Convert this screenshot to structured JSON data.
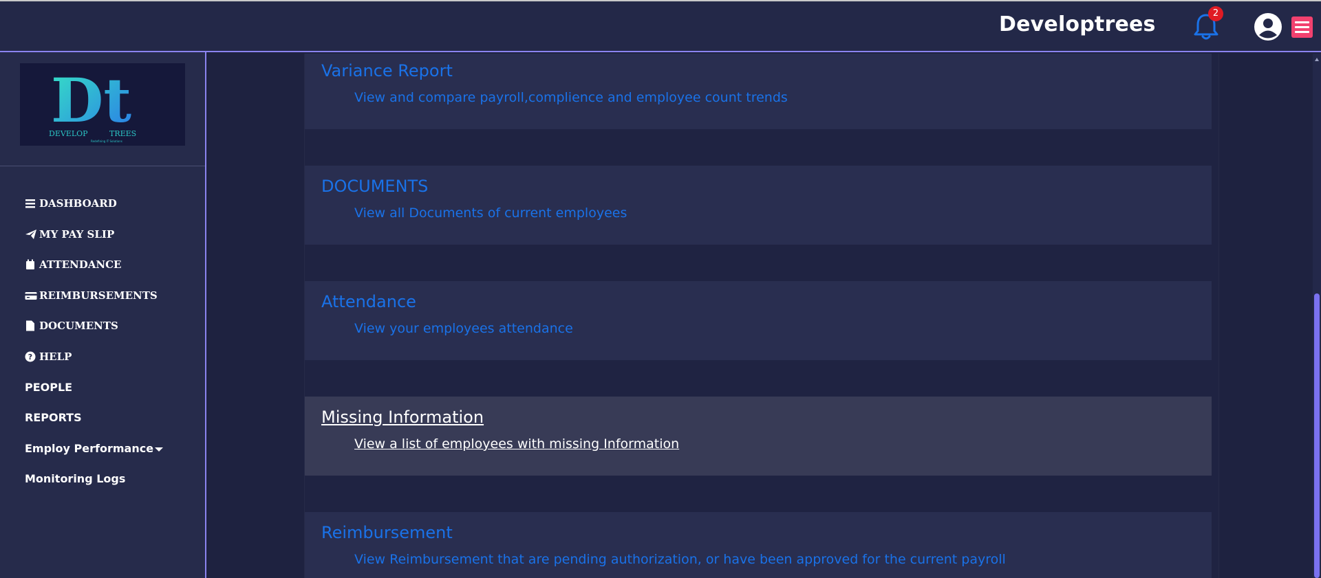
{
  "header": {
    "brand": "Developtrees",
    "notification_count": "2"
  },
  "logo": {
    "monogram": "Dt",
    "wordmark_left": "DEVELOP",
    "wordmark_right": "TREES",
    "tagline": "Redefining IT Solutions"
  },
  "sidebar": {
    "items": [
      {
        "label": "DASHBOARD",
        "icon": "bars-icon"
      },
      {
        "label": "MY PAY SLIP",
        "icon": "paper-plane-icon"
      },
      {
        "label": "ATTENDANCE",
        "icon": "calendar-icon"
      },
      {
        "label": "REIMBURSEMENTS",
        "icon": "credit-card-icon"
      },
      {
        "label": "DOCUMENTS",
        "icon": "file-icon"
      },
      {
        "label": "HELP",
        "icon": "question-circle-icon"
      },
      {
        "label": "PEOPLE",
        "icon": ""
      },
      {
        "label": "REPORTS",
        "icon": ""
      },
      {
        "label": "Employ Performance",
        "icon": "caret-down-icon"
      },
      {
        "label": "Monitoring Logs",
        "icon": ""
      }
    ]
  },
  "reports": [
    {
      "title": "Variance Report",
      "description": "View and compare payroll,complience and employee count trends"
    },
    {
      "title": "DOCUMENTS",
      "description": "View all Documents of current employees"
    },
    {
      "title": "Attendance",
      "description": "View your employees attendance"
    },
    {
      "title": "Missing Information",
      "description": "View a list of employees with missing Information"
    },
    {
      "title": "Reimbursement",
      "description": "View Reimbursement that are pending authorization, or have been approved for the current payroll"
    }
  ],
  "colors": {
    "link": "#1a72e8",
    "accent": "#8b84f0",
    "menu_button": "#f2416f",
    "badge": "#e01b24"
  }
}
